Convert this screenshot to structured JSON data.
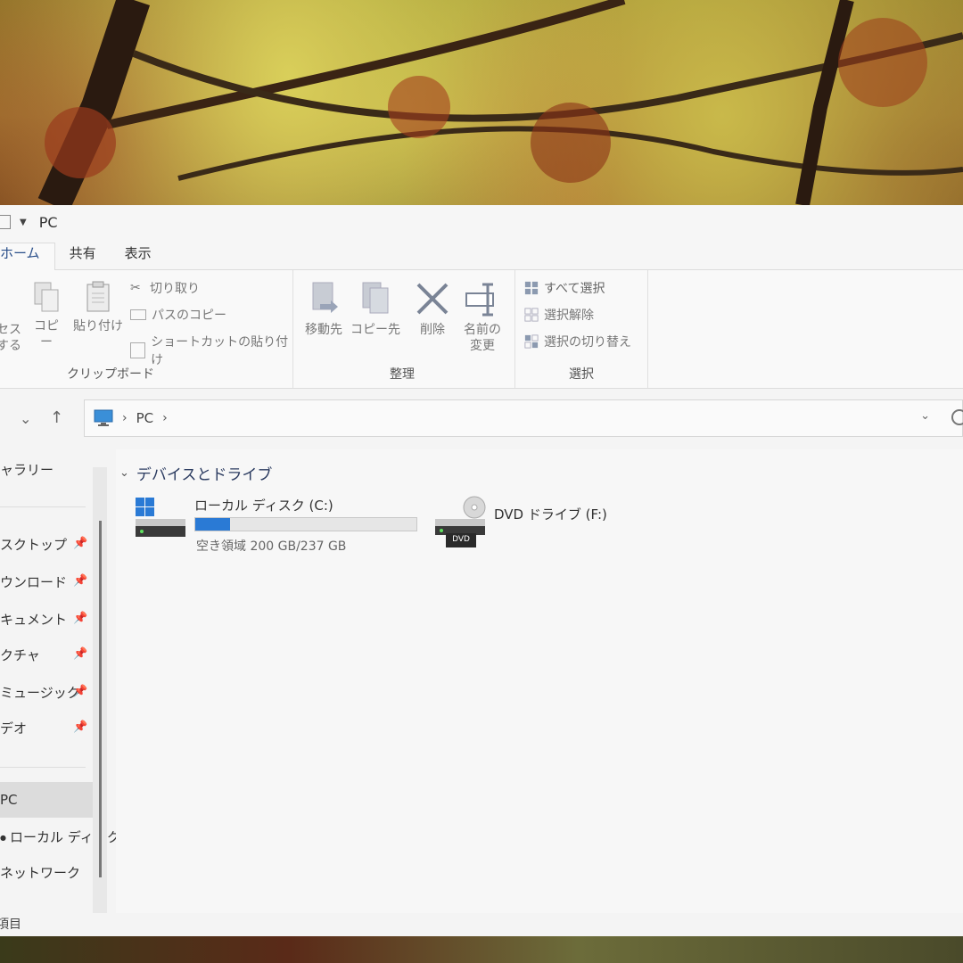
{
  "window": {
    "title": "PC"
  },
  "tabs": [
    {
      "label": "ホーム",
      "active": true
    },
    {
      "label": "共有",
      "active": false
    },
    {
      "label": "表示",
      "active": false
    }
  ],
  "ribbon": {
    "clipboard": {
      "label": "クリップボード",
      "access_line1": "セス",
      "access_line2": "する",
      "copy": "コピー",
      "paste": "貼り付け",
      "cut": "切り取り",
      "copy_path": "パスのコピー",
      "paste_shortcut": "ショートカットの貼り付け"
    },
    "organize": {
      "label": "整理",
      "move_to": "移動先",
      "copy_to": "コピー先",
      "delete": "削除",
      "rename_line1": "名前の",
      "rename_line2": "変更"
    },
    "select": {
      "label": "選択",
      "select_all": "すべて選択",
      "select_none": "選択解除",
      "invert": "選択の切り替え"
    }
  },
  "address": {
    "crumb": "PC"
  },
  "sidebar": {
    "items": [
      {
        "label": "ャラリー"
      },
      {
        "label": "スクトップ",
        "pinned": true
      },
      {
        "label": "ウンロード",
        "pinned": true
      },
      {
        "label": "キュメント",
        "pinned": true
      },
      {
        "label": "クチャ",
        "pinned": true
      },
      {
        "label": "ミュージック",
        "pinned": true
      },
      {
        "label": "デオ",
        "pinned": true
      },
      {
        "label": "PC",
        "selected": true
      },
      {
        "label": "ローカル ディスク"
      },
      {
        "label": "ネットワーク"
      }
    ]
  },
  "content": {
    "section_title": "デバイスとドライブ",
    "drives": [
      {
        "name": "ローカル ディスク (C:)",
        "free_text": "空き領域 200 GB/237 GB",
        "used_fraction": 0.156
      },
      {
        "name": "DVD ドライブ (F:)",
        "badge": "DVD"
      }
    ]
  },
  "status": {
    "text": "項目"
  },
  "colors": {
    "accent": "#2a7ad5",
    "selection": "#dcdcdc"
  }
}
